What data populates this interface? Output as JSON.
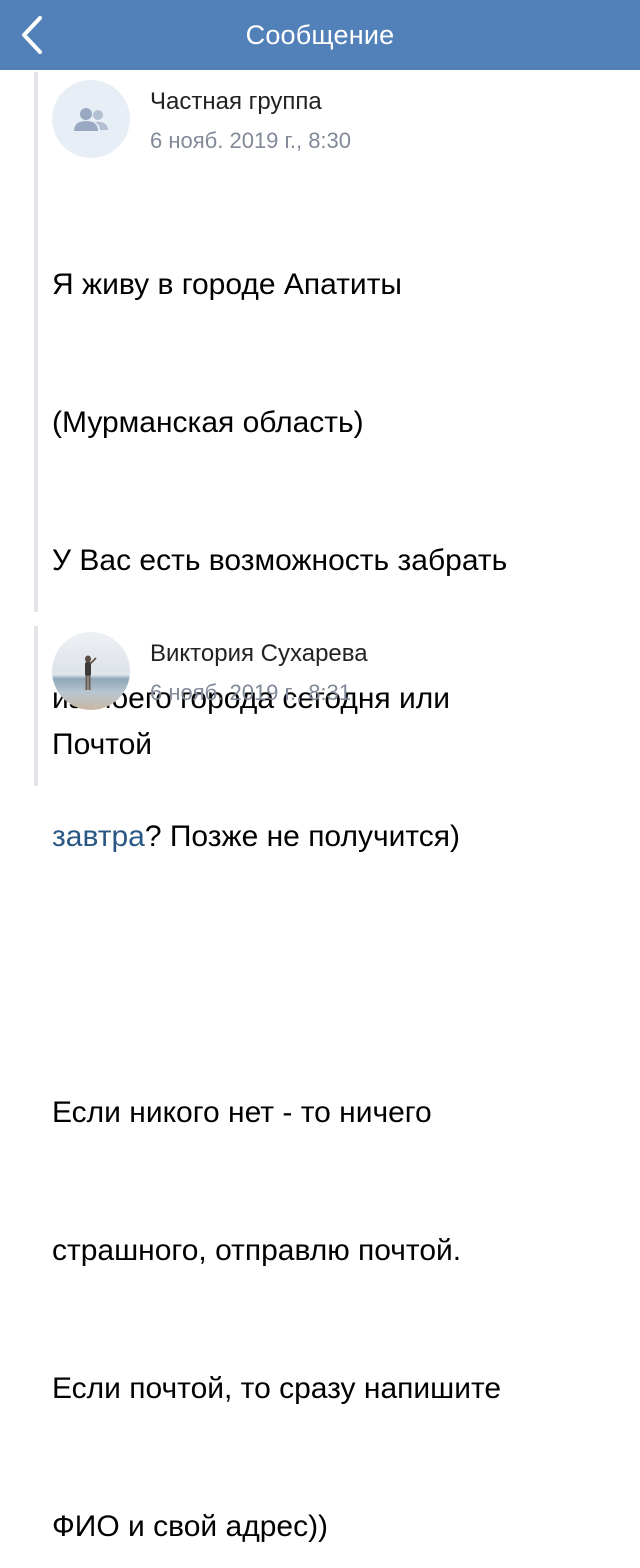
{
  "nav": {
    "title": "Сообщение",
    "back_icon": "chevron-left-icon",
    "background": "#5181b8"
  },
  "messages": [
    {
      "author": "Частная группа",
      "date": "6 нояб. 2019 г., 8:30",
      "avatar_icon": "group-users-icon",
      "text_lines": [
        "Я живу в городе Апатиты",
        "(Мурманская область)",
        "У Вас есть возможность забрать",
        "из моего города сегодня или"
      ],
      "link": "завтра",
      "after_link": "? Позже не получится)",
      "text_lines_2": [
        "",
        "Если никого нет - то ничего",
        "страшного, отправлю почтой.",
        "Если почтой, то сразу напишите",
        "ФИО и свой адрес))"
      ]
    },
    {
      "author": "Виктория Сухарева",
      "date": "6 нояб. 2019 г., 8:31",
      "avatar_icon": "user-photo-avatar",
      "text": "Почтой"
    }
  ],
  "colors": {
    "link": "#2a5885",
    "date": "#828a99",
    "thread_line": "#e3e5e8"
  }
}
